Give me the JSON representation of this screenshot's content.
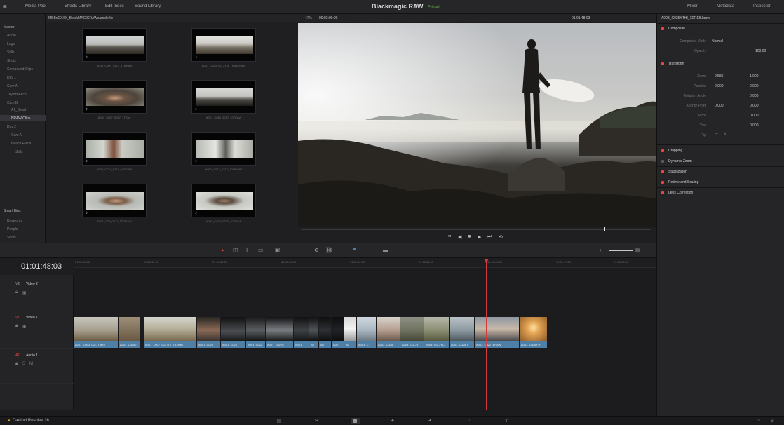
{
  "topbar": {
    "left_items": [
      "Media Pool",
      "Effects Library",
      "Edit Index",
      "Sound Library"
    ],
    "title": "Blackmagic RAW",
    "edited": "Edited",
    "right_items": [
      "Mixer",
      "Metadata",
      "Inspector"
    ]
  },
  "media_pool": {
    "bin_name": "MBBxCXXX_BlackMAGICRAWsamplefile",
    "sidebar": [
      "Master",
      "Audio",
      "Logs",
      "Stills",
      "Shots",
      "Compound Clips",
      "Day 1",
      "Cam A",
      "TaylorBeach",
      "Cam B",
      "A1_Beach",
      "BRAW Clips",
      "Day 2",
      "Cam A",
      "Beach Ferns",
      "Stills"
    ],
    "smart_bins_label": "Smart Bins",
    "smart_bins": [
      "Keywords",
      "People",
      "Shots"
    ],
    "thumbnails": [
      {
        "label": "A003_C003_0217_1TBeach",
        "marker": "♪"
      },
      {
        "label": "A001_C003_0217YM_TRIB8-RAW",
        "marker": "♪"
      },
      {
        "label": "A001_C007_0217_1TSurf",
        "marker": "♪"
      },
      {
        "label": "A001_C010_0217_10TEAW",
        "marker": "♪"
      },
      {
        "label": "A001_C011_0217_10TRAW",
        "marker": "♪"
      },
      {
        "label": "A001_C017_0217_10TRAW2",
        "marker": "♪"
      },
      {
        "label": "A001_C20_0217_1TORAW",
        "marker": "♪"
      },
      {
        "label": "A001_C022_0217_10TRAW",
        "marker": "♪"
      }
    ]
  },
  "viewer": {
    "zoom": "47%",
    "source_timecode": "00:02:09:00",
    "record_timecode": "01:01:48:03",
    "clip_name": "A003_C025YTHI_1DRE8.braw"
  },
  "inspector": {
    "sections": [
      "Composite",
      "Transform",
      "Cropping",
      "Dynamic Zoom",
      "Stabilization",
      "Retime and Scaling",
      "Lens Correction"
    ],
    "composite": {
      "mode_label": "Composite Mode",
      "mode_value": "Normal",
      "opacity_label": "Opacity",
      "opacity_value": "100.00"
    },
    "transform_rows": [
      {
        "label": "Zoom",
        "a": "0.585",
        "b": "1.000"
      },
      {
        "label": "Position",
        "a": "0.000",
        "b": "0.000"
      },
      {
        "label": "Rotation Angle",
        "a": "",
        "b": "0.000"
      },
      {
        "label": "Anchor Point",
        "a": "0.000",
        "b": "0.000"
      },
      {
        "label": "Pitch",
        "a": "",
        "b": "0.000"
      },
      {
        "label": "Yaw",
        "a": "",
        "b": "0.000"
      },
      {
        "label": "Flip",
        "a": "",
        "b": ""
      }
    ]
  },
  "timeline": {
    "timecode": "01:01:48:03",
    "ruler": [
      "01:00:00:00",
      "01:00:11:00",
      "01:00:22:00",
      "01:00:33:00",
      "01:00:44:00",
      "01:00:55:00",
      "01:01:06:00",
      "01:01:17:00",
      "01:01:28:00"
    ],
    "tracks": [
      {
        "code": "V2",
        "name": "Video 2"
      },
      {
        "code": "V1",
        "name": "Video 1"
      },
      {
        "code": "A1",
        "name": "Audio 1"
      }
    ],
    "clips": [
      "A001_C003_0217T8Ft3",
      "A003_C0050",
      "A001_C007_0217T4_TB.braw",
      "A001_C020",
      "A001_C021",
      "A001_C022",
      "A001_C022S",
      "A001",
      "A0",
      "A0",
      "A00",
      "A0",
      "A003_C",
      "A003_C024",
      "A003_C0171",
      "A003_C017YC",
      "A003_C025 T",
      "A003_C022TERAW",
      "A003_C025YTH"
    ]
  },
  "bottom_bar": {
    "brand": "DaVinci Resolve 16",
    "pages": [
      "Media",
      "Cut",
      "Edit",
      "Fusion",
      "Color",
      "Fairlight",
      "Deliver"
    ]
  },
  "colors": {
    "accent_red": "#e64b3c",
    "clip_blue": "#4e7fa6",
    "playhead": "#d23b3b"
  }
}
